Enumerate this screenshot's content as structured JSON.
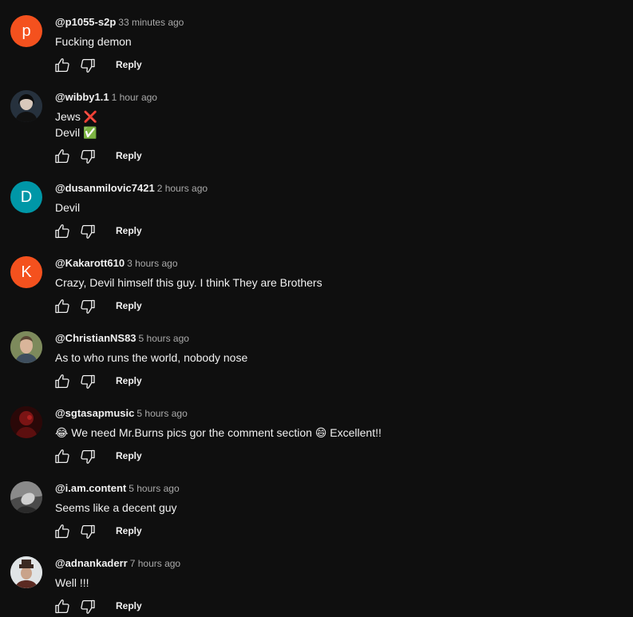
{
  "colors": {
    "background": "#0f0f0f",
    "text": "#f1f1f1",
    "muted": "#aaaaaa"
  },
  "actions": {
    "reply_label": "Reply",
    "like_icon": "thumbs-up-icon",
    "dislike_icon": "thumbs-down-icon"
  },
  "comments": [
    {
      "author": "@p1055-s2p",
      "time": "33 minutes ago",
      "avatar_letter": "P",
      "avatar_color": "#f4511e",
      "lines": [
        "Fucking demon"
      ]
    },
    {
      "author": "@wibby1.1",
      "time": "1 hour ago",
      "avatar_image": "photo-avatar",
      "lines": [
        "Jews ❌",
        "Devil ✅"
      ]
    },
    {
      "author": "@dusanmilovic7421",
      "time": "2 hours ago",
      "avatar_letter": "D",
      "avatar_color": "#0097a7",
      "lines": [
        "Devil"
      ]
    },
    {
      "author": "@Kakarott610",
      "time": "3 hours ago",
      "avatar_letter": "K",
      "avatar_color": "#f4511e",
      "lines": [
        "Crazy, Devil himself this guy. I think They are Brothers"
      ]
    },
    {
      "author": "@ChristianNS83",
      "time": "5 hours ago",
      "avatar_image": "photo-avatar",
      "lines": [
        "As to who runs the world, nobody nose"
      ]
    },
    {
      "author": "@sgtasapmusic",
      "time": "5 hours ago",
      "avatar_image": "photo-avatar",
      "lines": [
        "😂 We need Mr.Burns pics gor the comment section 😄  Excellent!!"
      ]
    },
    {
      "author": "@i.am.content",
      "time": "5 hours ago",
      "avatar_image": "photo-avatar",
      "lines": [
        "Seems like a decent guy"
      ]
    },
    {
      "author": "@adnankaderr",
      "time": "7 hours ago",
      "avatar_image": "photo-avatar",
      "lines": [
        "Well !!!"
      ]
    }
  ]
}
